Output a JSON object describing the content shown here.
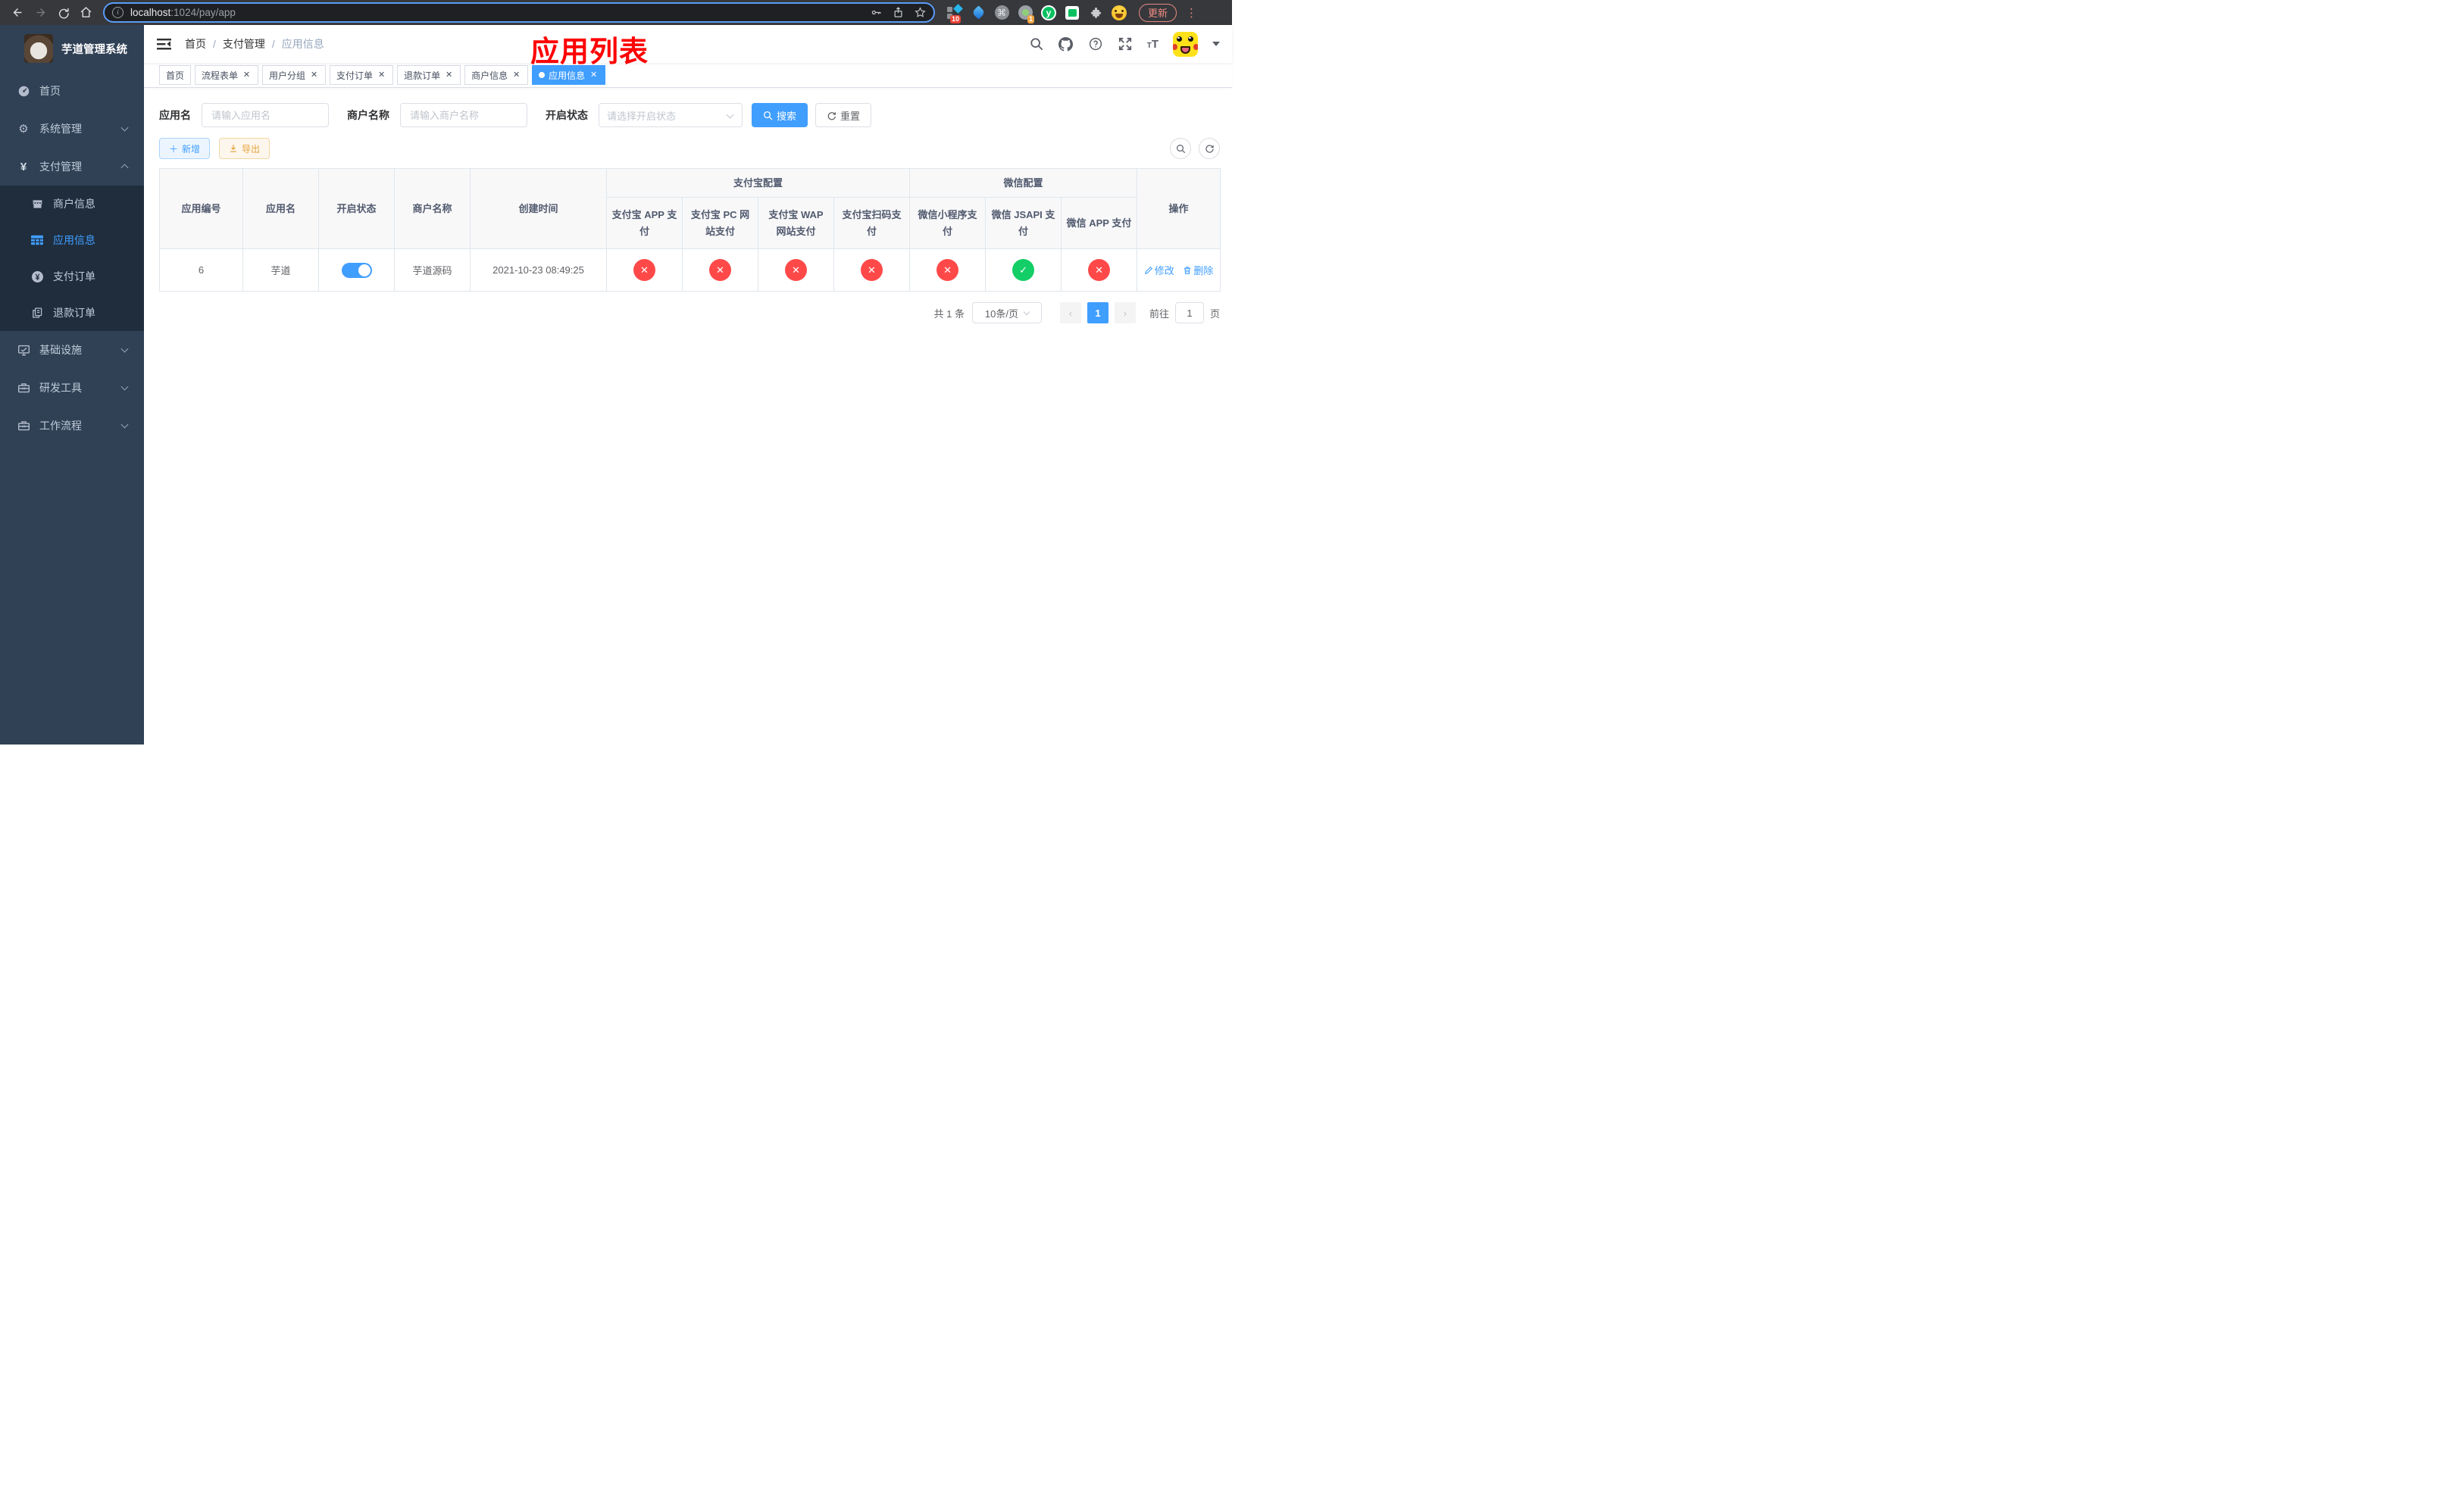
{
  "browser": {
    "url_host": "localhost",
    "url_path": ":1024/pay/app",
    "update_button": "更新",
    "ext_badge_red": "10",
    "ext_badge_orange": "1",
    "ext_letter_y": "y"
  },
  "sidebar": {
    "title": "芋道管理系统",
    "menu": [
      {
        "label": "首页"
      },
      {
        "label": "系统管理"
      },
      {
        "label": "支付管理"
      },
      {
        "label": "商户信息"
      },
      {
        "label": "应用信息"
      },
      {
        "label": "支付订单"
      },
      {
        "label": "退款订单"
      },
      {
        "label": "基础设施"
      },
      {
        "label": "研发工具"
      },
      {
        "label": "工作流程"
      }
    ]
  },
  "navbar": {
    "breadcrumb": {
      "home": "首页",
      "section": "支付管理",
      "current": "应用信息"
    },
    "annotation": "应用列表"
  },
  "tabs": {
    "items": [
      {
        "label": "首页"
      },
      {
        "label": "流程表单"
      },
      {
        "label": "用户分组"
      },
      {
        "label": "支付订单"
      },
      {
        "label": "退款订单"
      },
      {
        "label": "商户信息"
      },
      {
        "label": "应用信息"
      }
    ]
  },
  "filters": {
    "app_name_label": "应用名",
    "app_name_placeholder": "请输入应用名",
    "merchant_label": "商户名称",
    "merchant_placeholder": "请输入商户名称",
    "status_label": "开启状态",
    "status_placeholder": "请选择开启状态",
    "search_button": "搜索",
    "reset_button": "重置"
  },
  "toolbar": {
    "add_button": "新增",
    "export_button": "导出"
  },
  "table": {
    "columns": {
      "app_id": "应用编号",
      "app_name": "应用名",
      "status": "开启状态",
      "merchant": "商户名称",
      "created": "创建时间",
      "alipay_group": "支付宝配置",
      "alipay_app": "支付宝 APP 支付",
      "alipay_pc": "支付宝 PC 网站支付",
      "alipay_wap": "支付宝 WAP 网站支付",
      "alipay_qr": "支付宝扫码支付",
      "wechat_group": "微信配置",
      "wechat_lite": "微信小程序支付",
      "wechat_jsapi": "微信 JSAPI 支付",
      "wechat_app": "微信 APP 支付",
      "ops": "操作"
    },
    "row": {
      "app_id": "6",
      "app_name": "芋道",
      "merchant": "芋道源码",
      "created": "2021-10-23 08:49:25",
      "channels": [
        {
          "mark": "✕",
          "cls": "status-circle fail"
        },
        {
          "mark": "✕",
          "cls": "status-circle fail"
        },
        {
          "mark": "✕",
          "cls": "status-circle fail"
        },
        {
          "mark": "✕",
          "cls": "status-circle fail"
        },
        {
          "mark": "✕",
          "cls": "status-circle fail"
        },
        {
          "mark": "✓",
          "cls": "status-circle pass"
        },
        {
          "mark": "✕",
          "cls": "status-circle fail"
        }
      ],
      "edit": "修改",
      "delete": "删除"
    }
  },
  "pagination": {
    "total": "共 1 条",
    "page_size": "10条/页",
    "page": "1",
    "jump_prefix": "前往",
    "jump_value": "1",
    "jump_suffix": "页"
  }
}
